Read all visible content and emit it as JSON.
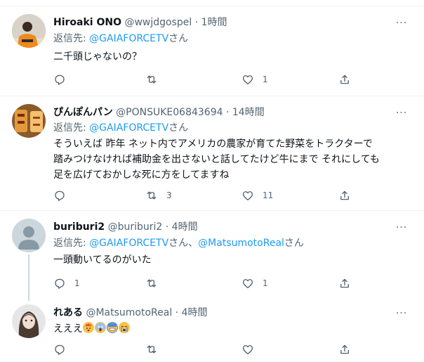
{
  "tweets": [
    {
      "name": "Hiroaki ONO",
      "handle": "@wwjdgospel",
      "dot": "·",
      "time": "1時間",
      "reply_prefix": "返信先: ",
      "reply_mention1": "@GAIAFORCETV",
      "reply_suffix": "さん",
      "lines": [
        "二千頭じゃないの？"
      ],
      "counts": {
        "reply": "",
        "retweet": "",
        "like": "1"
      }
    },
    {
      "name": "ぴんぽんパン",
      "handle": "@PONSUKE06843694",
      "dot": "·",
      "time": "14時間",
      "reply_prefix": "返信先: ",
      "reply_mention1": "@GAIAFORCETV",
      "reply_suffix": "さん",
      "lines": [
        "そういえば 昨年  ネット内でアメリカの農家が育てた野菜をトラクターで",
        "踏みつけなければ補助金を出さないと話してたけど牛にまで それにしても",
        "足を広げておかしな死に方をしてますね"
      ],
      "counts": {
        "reply": "",
        "retweet": "3",
        "like": "11"
      }
    },
    {
      "name": "buriburi2",
      "handle": "@buriburi2",
      "dot": "·",
      "time": "4時間",
      "reply_prefix": "返信先: ",
      "reply_mention1": "@GAIAFORCETV",
      "reply_mid": "さん、",
      "reply_mention2": "@MatsumotoReal",
      "reply_suffix": "さん",
      "lines": [
        "一頭動いてるのがいた"
      ],
      "counts": {
        "reply": "1",
        "retweet": "",
        "like": "1"
      }
    },
    {
      "name": "れある",
      "handle": "@MatsumotoReal",
      "dot": "·",
      "time": "4時間",
      "lines": [
        "えええ"
      ],
      "emojis": [
        "exploding-head",
        "scream",
        "sweat-smile",
        "loudly-crying"
      ],
      "counts": {
        "reply": "",
        "retweet": "",
        "like": ""
      }
    }
  ],
  "more_label": "···",
  "colors": {
    "accent": "#1d9bf0",
    "muted": "#536471",
    "text": "#0f1419",
    "border": "#eff3f4"
  }
}
